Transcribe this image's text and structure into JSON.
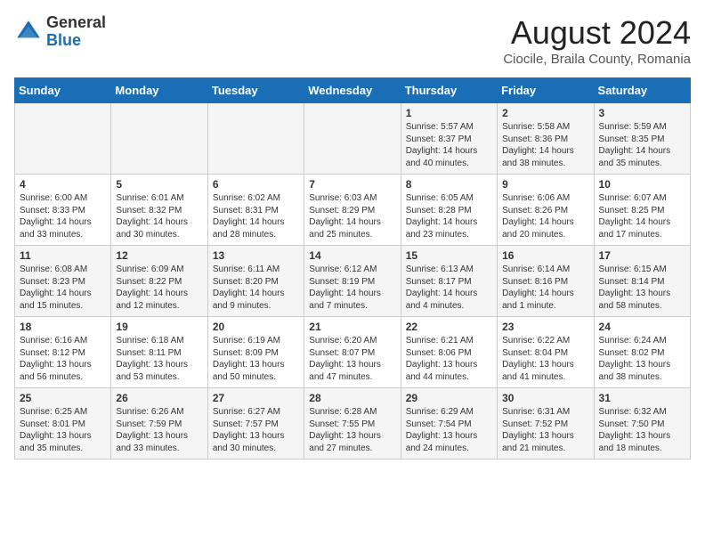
{
  "header": {
    "logo_general": "General",
    "logo_blue": "Blue",
    "month_title": "August 2024",
    "location": "Ciocile, Braila County, Romania"
  },
  "weekdays": [
    "Sunday",
    "Monday",
    "Tuesday",
    "Wednesday",
    "Thursday",
    "Friday",
    "Saturday"
  ],
  "weeks": [
    [
      {
        "day": "",
        "text": ""
      },
      {
        "day": "",
        "text": ""
      },
      {
        "day": "",
        "text": ""
      },
      {
        "day": "",
        "text": ""
      },
      {
        "day": "1",
        "text": "Sunrise: 5:57 AM\nSunset: 8:37 PM\nDaylight: 14 hours\nand 40 minutes."
      },
      {
        "day": "2",
        "text": "Sunrise: 5:58 AM\nSunset: 8:36 PM\nDaylight: 14 hours\nand 38 minutes."
      },
      {
        "day": "3",
        "text": "Sunrise: 5:59 AM\nSunset: 8:35 PM\nDaylight: 14 hours\nand 35 minutes."
      }
    ],
    [
      {
        "day": "4",
        "text": "Sunrise: 6:00 AM\nSunset: 8:33 PM\nDaylight: 14 hours\nand 33 minutes."
      },
      {
        "day": "5",
        "text": "Sunrise: 6:01 AM\nSunset: 8:32 PM\nDaylight: 14 hours\nand 30 minutes."
      },
      {
        "day": "6",
        "text": "Sunrise: 6:02 AM\nSunset: 8:31 PM\nDaylight: 14 hours\nand 28 minutes."
      },
      {
        "day": "7",
        "text": "Sunrise: 6:03 AM\nSunset: 8:29 PM\nDaylight: 14 hours\nand 25 minutes."
      },
      {
        "day": "8",
        "text": "Sunrise: 6:05 AM\nSunset: 8:28 PM\nDaylight: 14 hours\nand 23 minutes."
      },
      {
        "day": "9",
        "text": "Sunrise: 6:06 AM\nSunset: 8:26 PM\nDaylight: 14 hours\nand 20 minutes."
      },
      {
        "day": "10",
        "text": "Sunrise: 6:07 AM\nSunset: 8:25 PM\nDaylight: 14 hours\nand 17 minutes."
      }
    ],
    [
      {
        "day": "11",
        "text": "Sunrise: 6:08 AM\nSunset: 8:23 PM\nDaylight: 14 hours\nand 15 minutes."
      },
      {
        "day": "12",
        "text": "Sunrise: 6:09 AM\nSunset: 8:22 PM\nDaylight: 14 hours\nand 12 minutes."
      },
      {
        "day": "13",
        "text": "Sunrise: 6:11 AM\nSunset: 8:20 PM\nDaylight: 14 hours\nand 9 minutes."
      },
      {
        "day": "14",
        "text": "Sunrise: 6:12 AM\nSunset: 8:19 PM\nDaylight: 14 hours\nand 7 minutes."
      },
      {
        "day": "15",
        "text": "Sunrise: 6:13 AM\nSunset: 8:17 PM\nDaylight: 14 hours\nand 4 minutes."
      },
      {
        "day": "16",
        "text": "Sunrise: 6:14 AM\nSunset: 8:16 PM\nDaylight: 14 hours\nand 1 minute."
      },
      {
        "day": "17",
        "text": "Sunrise: 6:15 AM\nSunset: 8:14 PM\nDaylight: 13 hours\nand 58 minutes."
      }
    ],
    [
      {
        "day": "18",
        "text": "Sunrise: 6:16 AM\nSunset: 8:12 PM\nDaylight: 13 hours\nand 56 minutes."
      },
      {
        "day": "19",
        "text": "Sunrise: 6:18 AM\nSunset: 8:11 PM\nDaylight: 13 hours\nand 53 minutes."
      },
      {
        "day": "20",
        "text": "Sunrise: 6:19 AM\nSunset: 8:09 PM\nDaylight: 13 hours\nand 50 minutes."
      },
      {
        "day": "21",
        "text": "Sunrise: 6:20 AM\nSunset: 8:07 PM\nDaylight: 13 hours\nand 47 minutes."
      },
      {
        "day": "22",
        "text": "Sunrise: 6:21 AM\nSunset: 8:06 PM\nDaylight: 13 hours\nand 44 minutes."
      },
      {
        "day": "23",
        "text": "Sunrise: 6:22 AM\nSunset: 8:04 PM\nDaylight: 13 hours\nand 41 minutes."
      },
      {
        "day": "24",
        "text": "Sunrise: 6:24 AM\nSunset: 8:02 PM\nDaylight: 13 hours\nand 38 minutes."
      }
    ],
    [
      {
        "day": "25",
        "text": "Sunrise: 6:25 AM\nSunset: 8:01 PM\nDaylight: 13 hours\nand 35 minutes."
      },
      {
        "day": "26",
        "text": "Sunrise: 6:26 AM\nSunset: 7:59 PM\nDaylight: 13 hours\nand 33 minutes."
      },
      {
        "day": "27",
        "text": "Sunrise: 6:27 AM\nSunset: 7:57 PM\nDaylight: 13 hours\nand 30 minutes."
      },
      {
        "day": "28",
        "text": "Sunrise: 6:28 AM\nSunset: 7:55 PM\nDaylight: 13 hours\nand 27 minutes."
      },
      {
        "day": "29",
        "text": "Sunrise: 6:29 AM\nSunset: 7:54 PM\nDaylight: 13 hours\nand 24 minutes."
      },
      {
        "day": "30",
        "text": "Sunrise: 6:31 AM\nSunset: 7:52 PM\nDaylight: 13 hours\nand 21 minutes."
      },
      {
        "day": "31",
        "text": "Sunrise: 6:32 AM\nSunset: 7:50 PM\nDaylight: 13 hours\nand 18 minutes."
      }
    ]
  ]
}
